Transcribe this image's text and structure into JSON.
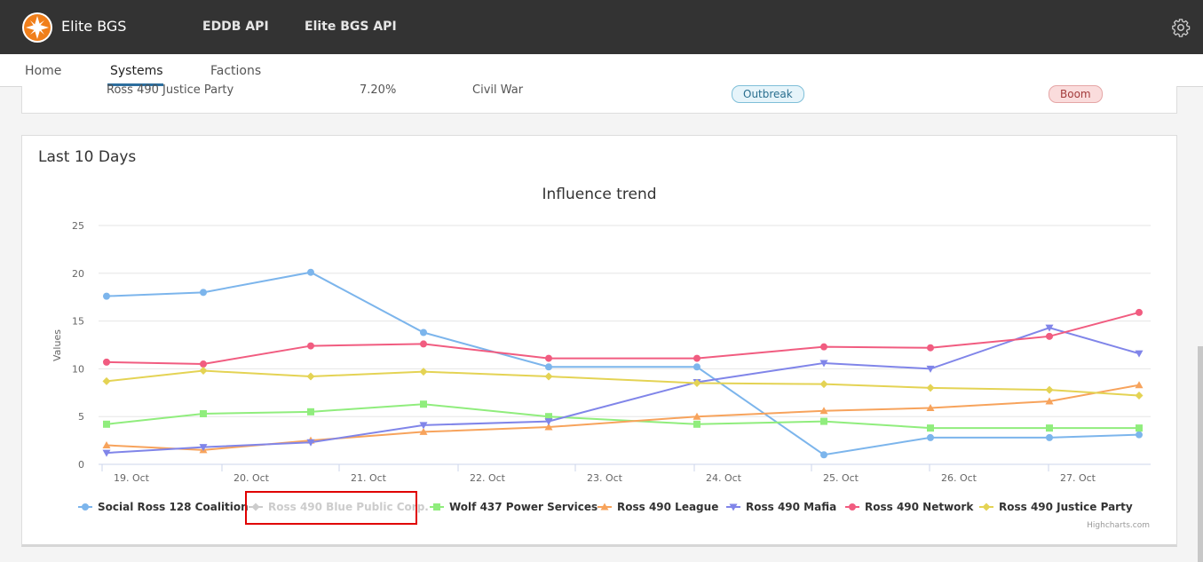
{
  "topbar": {
    "brand": "Elite BGS",
    "links": [
      "EDDB API",
      "Elite BGS API"
    ]
  },
  "subnav": {
    "items": [
      "Home",
      "Systems",
      "Factions"
    ],
    "active": "Systems"
  },
  "table_row": {
    "faction": "Ross 490 Justice Party",
    "influence": "7.20%",
    "state": "Civil War",
    "pending": "Outbreak",
    "recovering": "Boom"
  },
  "card": {
    "title": "Last 10 Days"
  },
  "credits": "Highcharts.com",
  "chart_data": {
    "type": "line",
    "title": "Influence trend",
    "ylabel": "Values",
    "ylim": [
      0,
      25
    ],
    "yticks": [
      0,
      5,
      10,
      15,
      20,
      25
    ],
    "xticks": [
      "19. Oct",
      "20. Oct",
      "21. Oct",
      "22. Oct",
      "23. Oct",
      "24. Oct",
      "25. Oct",
      "26. Oct",
      "27. Oct"
    ],
    "x": [
      "18.8 Oct",
      "19.7 Oct",
      "20.5 Oct",
      "21.5 Oct",
      "22.5 Oct",
      "23.8 Oct",
      "24.9 Oct",
      "25.8 Oct",
      "26.8 Oct",
      "27.5 Oct"
    ],
    "series": [
      {
        "name": "Social Ross 128 Coalition",
        "color": "#7cb5ec",
        "marker": "circle",
        "values": [
          17.6,
          18.0,
          20.1,
          13.8,
          10.2,
          10.2,
          1.0,
          2.8,
          2.8,
          3.1
        ]
      },
      {
        "name": "Ross 490 Blue Public Corp.",
        "color": "#cccccc",
        "marker": "diamond",
        "hidden": true,
        "values": []
      },
      {
        "name": "Wolf 437 Power Services",
        "color": "#90ed7d",
        "marker": "square",
        "values": [
          4.2,
          5.3,
          5.5,
          6.3,
          5.0,
          4.2,
          4.5,
          3.8,
          3.8,
          3.8
        ]
      },
      {
        "name": "Ross 490 League",
        "color": "#f7a35c",
        "marker": "triangle",
        "values": [
          2.0,
          1.5,
          2.5,
          3.4,
          3.9,
          5.0,
          5.6,
          5.9,
          6.6,
          8.3
        ]
      },
      {
        "name": "Ross 490 Mafia",
        "color": "#8085e9",
        "marker": "triangle-down",
        "values": [
          1.2,
          1.8,
          2.3,
          4.1,
          4.5,
          8.6,
          10.6,
          10.0,
          14.3,
          11.6
        ]
      },
      {
        "name": "Ross 490 Network",
        "color": "#f15c80",
        "marker": "circle",
        "values": [
          10.7,
          10.5,
          12.4,
          12.6,
          11.1,
          11.1,
          12.3,
          12.2,
          13.4,
          15.9
        ]
      },
      {
        "name": "Ross 490 Justice Party",
        "color": "#e4d354",
        "marker": "diamond",
        "values": [
          8.7,
          9.8,
          9.2,
          9.7,
          9.2,
          8.5,
          8.4,
          8.0,
          7.8,
          7.2
        ]
      }
    ],
    "grid": true,
    "legend": "bottom"
  }
}
